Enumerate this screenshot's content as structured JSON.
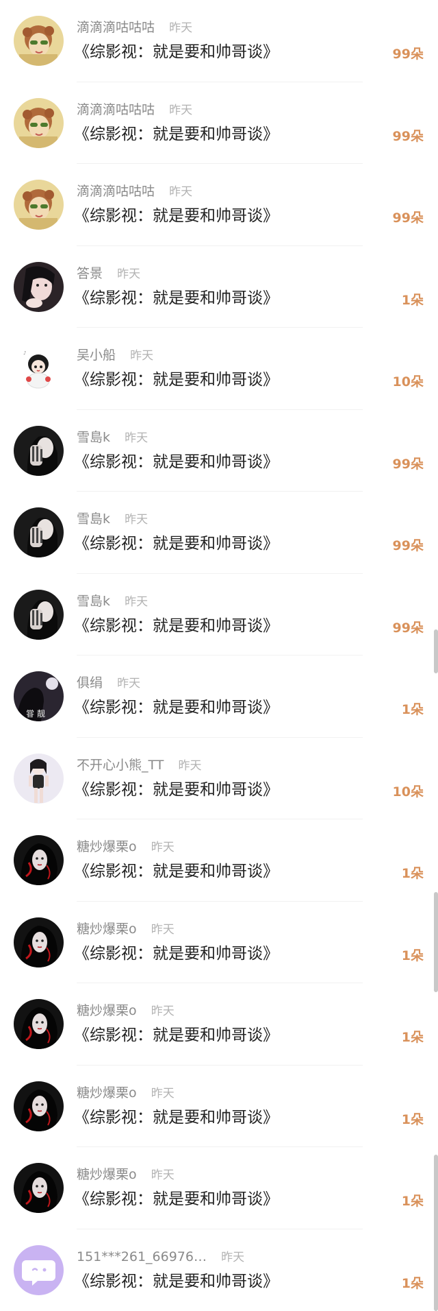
{
  "gift_list": {
    "items": [
      {
        "username": "滴滴滴咕咕咕",
        "time": "昨天",
        "book_title": "《综影视：就是要和帅哥谈》",
        "amount": "99朵",
        "avatar": "avatar-cartoon-girl"
      },
      {
        "username": "滴滴滴咕咕咕",
        "time": "昨天",
        "book_title": "《综影视：就是要和帅哥谈》",
        "amount": "99朵",
        "avatar": "avatar-cartoon-girl"
      },
      {
        "username": "滴滴滴咕咕咕",
        "time": "昨天",
        "book_title": "《综影视：就是要和帅哥谈》",
        "amount": "99朵",
        "avatar": "avatar-cartoon-girl"
      },
      {
        "username": "答景",
        "time": "昨天",
        "book_title": "《综影视：就是要和帅哥谈》",
        "amount": "1朵",
        "avatar": "avatar-photo-girl"
      },
      {
        "username": "吴小船",
        "time": "昨天",
        "book_title": "《综影视：就是要和帅哥谈》",
        "amount": "10朵",
        "avatar": "avatar-chibi"
      },
      {
        "username": "雪島k",
        "time": "昨天",
        "book_title": "《综影视：就是要和帅哥谈》",
        "amount": "99朵",
        "avatar": "avatar-dark-hand"
      },
      {
        "username": "雪島k",
        "time": "昨天",
        "book_title": "《综影视：就是要和帅哥谈》",
        "amount": "99朵",
        "avatar": "avatar-dark-hand"
      },
      {
        "username": "雪島k",
        "time": "昨天",
        "book_title": "《综影视：就是要和帅哥谈》",
        "amount": "99朵",
        "avatar": "avatar-dark-hand"
      },
      {
        "username": "俱绢",
        "time": "昨天",
        "book_title": "《综影视：就是要和帅哥谈》",
        "amount": "1朵",
        "avatar": "avatar-night-silhouette"
      },
      {
        "username": "不开心小熊_TT",
        "time": "昨天",
        "book_title": "《综影视：就是要和帅哥谈》",
        "amount": "10朵",
        "avatar": "avatar-full-body"
      },
      {
        "username": "糖炒爆栗o",
        "time": "昨天",
        "book_title": "《综影视：就是要和帅哥谈》",
        "amount": "1朵",
        "avatar": "avatar-dark-red"
      },
      {
        "username": "糖炒爆栗o",
        "time": "昨天",
        "book_title": "《综影视：就是要和帅哥谈》",
        "amount": "1朵",
        "avatar": "avatar-dark-red"
      },
      {
        "username": "糖炒爆栗o",
        "time": "昨天",
        "book_title": "《综影视：就是要和帅哥谈》",
        "amount": "1朵",
        "avatar": "avatar-dark-red"
      },
      {
        "username": "糖炒爆栗o",
        "time": "昨天",
        "book_title": "《综影视：就是要和帅哥谈》",
        "amount": "1朵",
        "avatar": "avatar-dark-red"
      },
      {
        "username": "糖炒爆栗o",
        "time": "昨天",
        "book_title": "《综影视：就是要和帅哥谈》",
        "amount": "1朵",
        "avatar": "avatar-dark-red"
      },
      {
        "username": "151***261_66976…",
        "time": "昨天",
        "book_title": "《综影视：就是要和帅哥谈》",
        "amount": "1朵",
        "avatar": "avatar-default-chat"
      }
    ]
  },
  "colors": {
    "amount": "#d9915a",
    "username": "#8a8a8a",
    "time": "#b2b2b2",
    "title": "#222222",
    "default_avatar": "#c9b3f2"
  }
}
